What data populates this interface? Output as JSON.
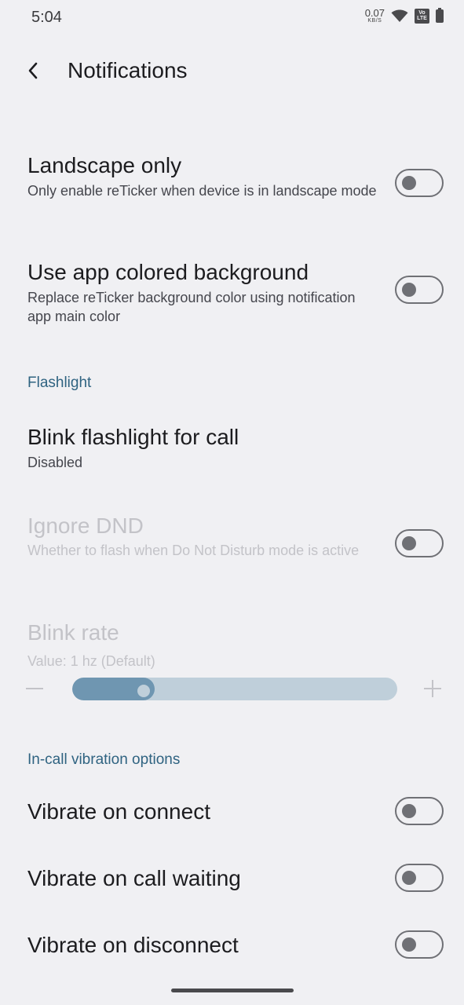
{
  "status_bar": {
    "time": "5:04",
    "net_speed_value": "0.07",
    "net_speed_unit": "KB/S",
    "volte_top": "Vo",
    "volte_bottom": "LTE"
  },
  "app_bar": {
    "title": "Notifications"
  },
  "prefs": {
    "landscape_only": {
      "title": "Landscape only",
      "summary": "Only enable reTicker when device is in landscape mode",
      "checked": false
    },
    "app_colored_bg": {
      "title": "Use app colored background",
      "summary": "Replace reTicker background color using notification app main color",
      "checked": false
    }
  },
  "flashlight": {
    "header": "Flashlight",
    "blink_call": {
      "title": "Blink flashlight for call",
      "summary": "Disabled"
    },
    "ignore_dnd": {
      "title": "Ignore DND",
      "summary": "Whether to flash when Do Not Disturb mode is active",
      "checked": false
    },
    "blink_rate": {
      "title": "Blink rate",
      "summary": "Value: 1 hz (Default)",
      "fraction": 0.22
    }
  },
  "incall": {
    "header": "In-call vibration options",
    "vibrate_connect": {
      "title": "Vibrate on connect",
      "checked": false
    },
    "vibrate_waiting": {
      "title": "Vibrate on call waiting",
      "checked": false
    },
    "vibrate_disconnect": {
      "title": "Vibrate on disconnect",
      "checked": false
    }
  },
  "colors": {
    "accent": "#2f6381",
    "slider_fill": "#6f96b1",
    "slider_track": "#bfcfda",
    "background": "#f0f0f3"
  }
}
